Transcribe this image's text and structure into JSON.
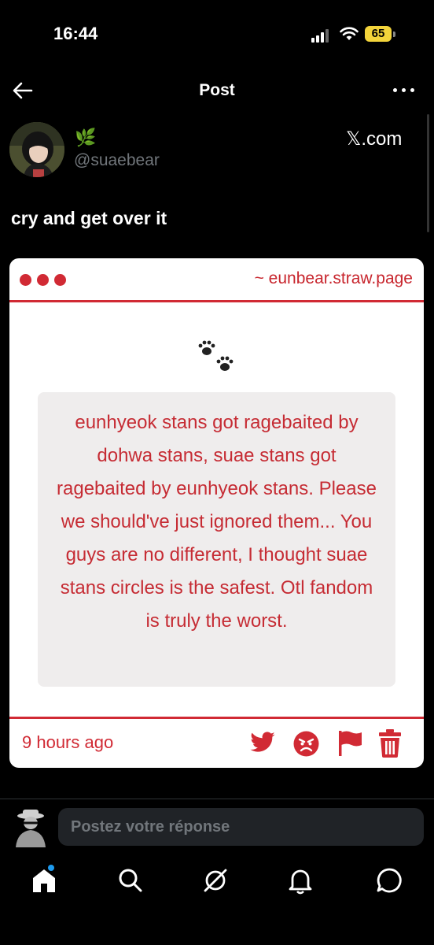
{
  "status_bar": {
    "time": "16:44",
    "battery": "65"
  },
  "header": {
    "title": "Post"
  },
  "post": {
    "handle": "@suaebear",
    "name_emoji": "🌿",
    "source_label": "𝕏.com",
    "text": "cry and get over it"
  },
  "card": {
    "url": "~ eunbear.straw.page",
    "message": "eunhyeok stans got ragebaited by dohwa stans, suae stans got ragebaited by eunhyeok stans. Please we should've just ignored them... You guys are no different, I thought suae stans circles is the safest. Otl fandom is truly the worst.",
    "time_ago": "9 hours ago"
  },
  "reply": {
    "placeholder": "Postez votre réponse"
  },
  "colors": {
    "accent_red": "#d12a34",
    "background": "#000000",
    "badge_blue": "#1d9bf0"
  },
  "icons": [
    "back-arrow-icon",
    "more-icon",
    "paw-prints-icon",
    "twitter-bird-icon",
    "angry-face-icon",
    "flag-icon",
    "trash-icon",
    "home-icon",
    "search-icon",
    "grok-icon",
    "bell-icon",
    "message-icon"
  ]
}
